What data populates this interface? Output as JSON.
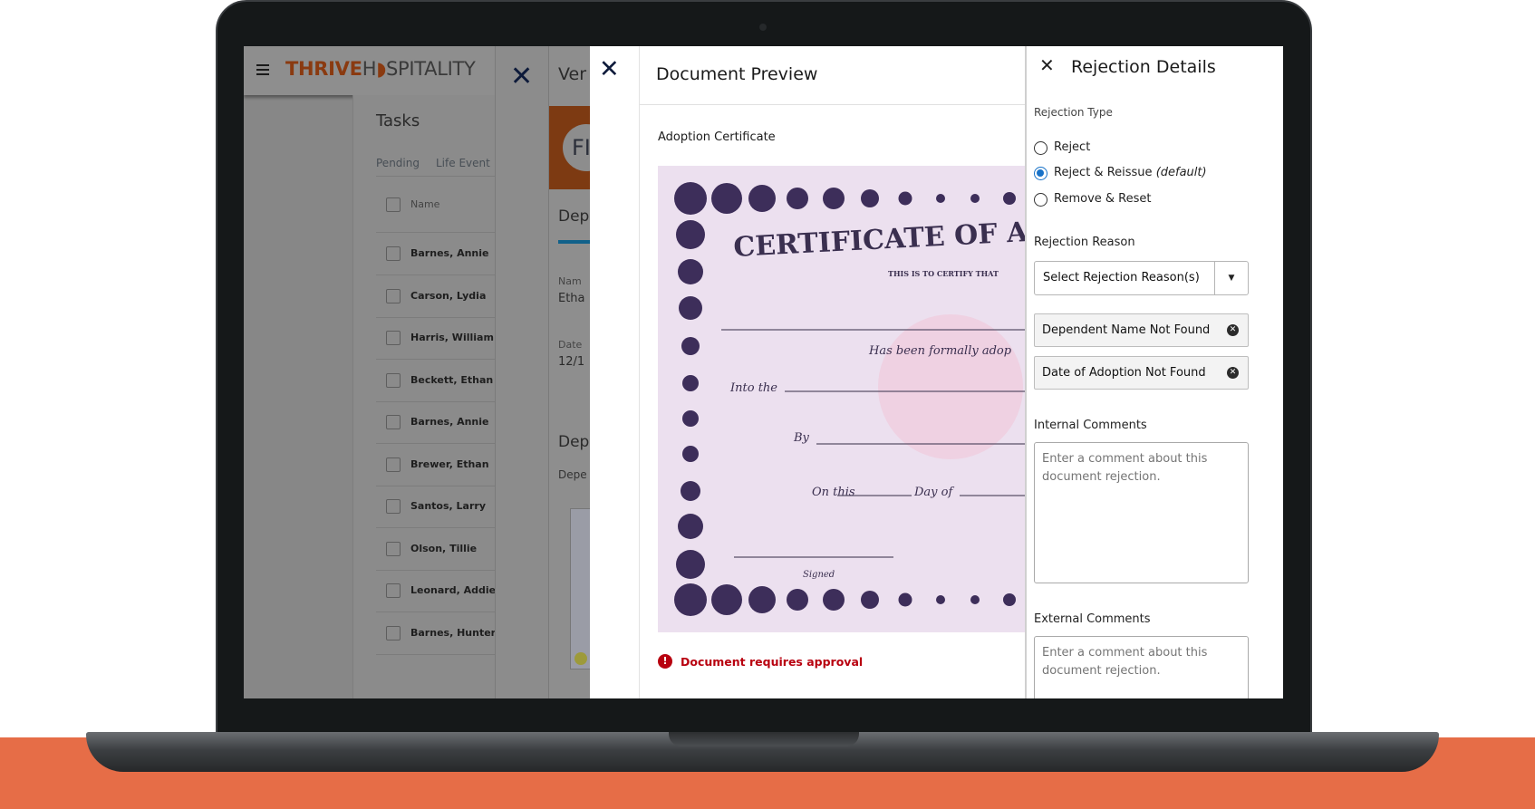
{
  "app": {
    "logo_bold": "THRIVE",
    "logo_light": "H",
    "logo_rest": "SPITALITY",
    "brand_color": "#a8410f",
    "accent": "#1872c8"
  },
  "tasks": {
    "title": "Tasks",
    "tabs": [
      "Pending",
      "Life Event"
    ],
    "column_name": "Name",
    "rows": [
      "Barnes, Annie",
      "Carson, Lydia",
      "Harris, William",
      "Beckett, Ethan",
      "Barnes, Annie",
      "Brewer, Ethan",
      "Santos, Larry",
      "Olson, Tillie",
      "Leonard, Addie",
      "Barnes, Hunter"
    ]
  },
  "verify": {
    "title": "Ver",
    "avatar": "FI",
    "section": "Dep",
    "name_label": "Nam",
    "name_value": "Etha",
    "date_label": "Date",
    "date_value": "12/1",
    "section2": "Dep",
    "section2_sub": "Depe"
  },
  "doc_preview": {
    "title": "Document Preview",
    "doc_name": "Adoption Certificate",
    "status": "Document requires approval",
    "certificate": {
      "heading": "CERTIFICATE OF A",
      "certify": "THIS IS TO CERTIFY THAT",
      "adopted": "Has been formally adop",
      "into": "Into the",
      "by": "By",
      "on_this": "On this",
      "day_of": "Day of",
      "signed": "Signed"
    }
  },
  "rejection": {
    "title": "Rejection Details",
    "type_label": "Rejection Type",
    "options": [
      {
        "label": "Reject",
        "selected": false
      },
      {
        "label": "Reject & Reissue",
        "note": "(default)",
        "selected": true
      },
      {
        "label": "Remove & Reset",
        "selected": false
      }
    ],
    "reason_label": "Rejection Reason",
    "reason_select": "Select Rejection Reason(s)",
    "chips": [
      "Dependent Name Not Found",
      "Date of Adoption Not Found"
    ],
    "internal_label": "Internal Comments",
    "internal_placeholder": "Enter a comment about this document rejection.",
    "external_label": "External Comments",
    "external_placeholder": "Enter a comment about this document rejection."
  }
}
